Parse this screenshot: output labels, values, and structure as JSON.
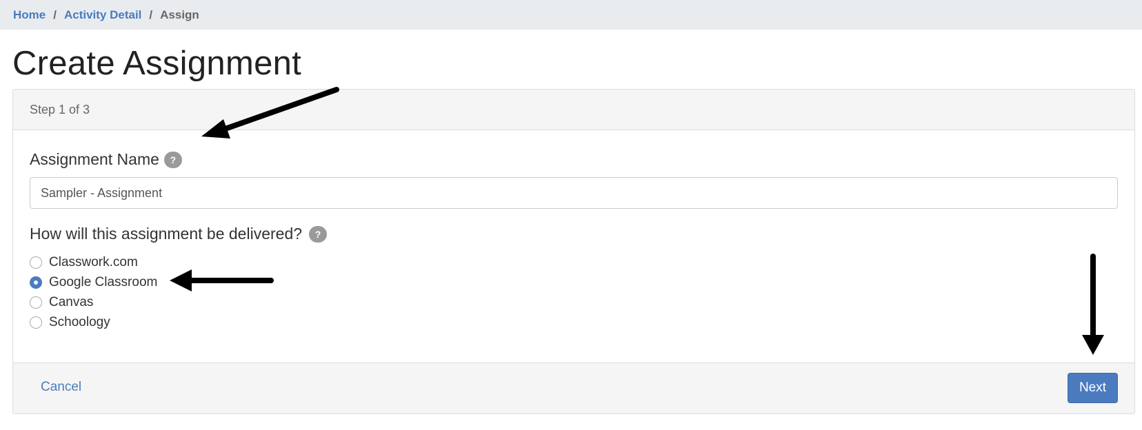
{
  "breadcrumb": {
    "home": "Home",
    "activity_detail": "Activity Detail",
    "current": "Assign",
    "separator": "/"
  },
  "page": {
    "title": "Create Assignment"
  },
  "card": {
    "step": "Step 1 of 3",
    "assignment_name_label": "Assignment Name",
    "assignment_name_value": "Sampler - Assignment",
    "help_glyph": "?",
    "delivery_question": "How will this assignment be delivered?",
    "delivery_options": [
      {
        "label": "Classwork.com",
        "selected": false
      },
      {
        "label": "Google Classroom",
        "selected": true
      },
      {
        "label": "Canvas",
        "selected": false
      },
      {
        "label": "Schoology",
        "selected": false
      }
    ]
  },
  "footer": {
    "cancel_label": "Cancel",
    "next_label": "Next"
  },
  "colors": {
    "accent": "#4a7bbf",
    "header_bg": "#e9ecef",
    "card_header_bg": "#f5f5f5",
    "help_badge": "#9a9a9a",
    "annotation_arrow": "#000000"
  },
  "annotations": {
    "arrows_icon": "arrow-icon"
  }
}
